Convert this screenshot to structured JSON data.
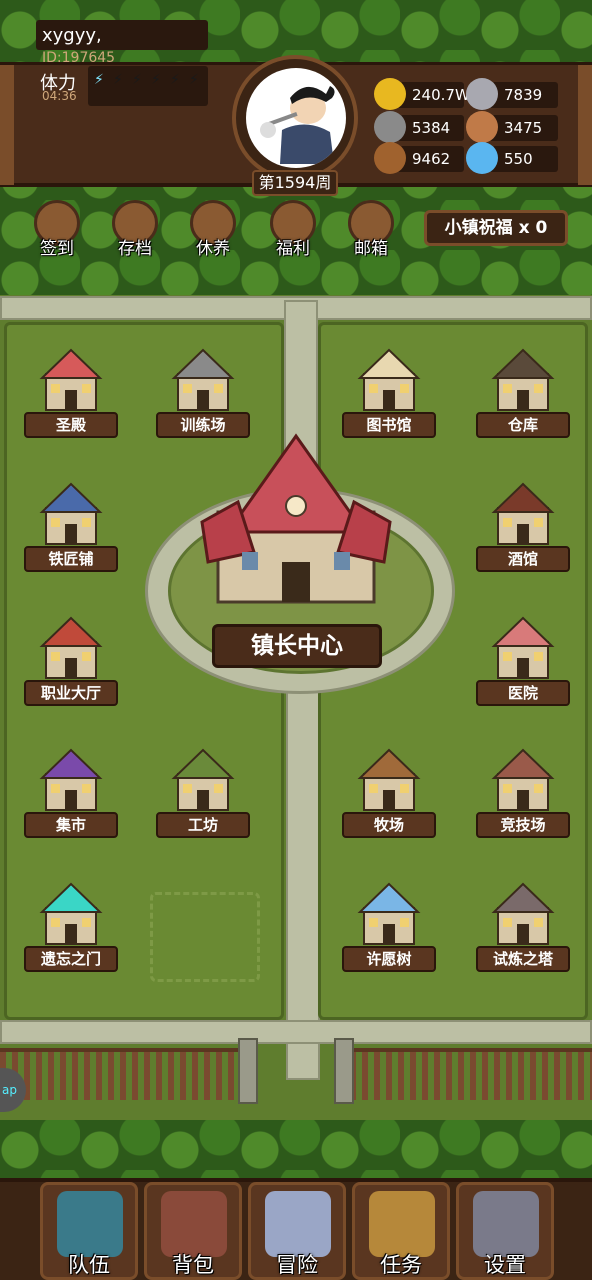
{
  "player": {
    "name": "xygyy,",
    "id": "ID:197645",
    "stamina_label": "体力",
    "stamina_timer": "04:36",
    "stamina_filled": 1,
    "stamina_max": 6
  },
  "week": "第1594周",
  "resources": [
    {
      "icon": "gold-coin-icon",
      "value": "240.7W",
      "color": "#e8b820"
    },
    {
      "icon": "iron-ingot-icon",
      "value": "7839",
      "color": "#a8a8b0"
    },
    {
      "icon": "stone-icon",
      "value": "5384",
      "color": "#8a8a8a"
    },
    {
      "icon": "leather-icon",
      "value": "3475",
      "color": "#c07a48"
    },
    {
      "icon": "wood-log-icon",
      "value": "9462",
      "color": "#a0622e"
    },
    {
      "icon": "crystal-icon",
      "value": "550",
      "color": "#5ab6f0"
    }
  ],
  "quick_actions": [
    {
      "label": "签到",
      "icon": "quill-scroll-icon"
    },
    {
      "label": "存档",
      "icon": "save-scroll-icon"
    },
    {
      "label": "休养",
      "icon": "rest-scroll-icon"
    },
    {
      "label": "福利",
      "icon": "shield-reward-icon"
    },
    {
      "label": "邮箱",
      "icon": "mail-icon"
    }
  ],
  "blessing": "小镇祝福 x 0",
  "buildings": [
    {
      "label": "圣殿",
      "icon": "temple-icon",
      "color": "#d65a5a"
    },
    {
      "label": "训练场",
      "icon": "training-ground-icon",
      "color": "#8a8a8a"
    },
    {
      "label": "图书馆",
      "icon": "library-icon",
      "color": "#e8d8b0"
    },
    {
      "label": "仓库",
      "icon": "warehouse-icon",
      "color": "#5a4a3a"
    },
    {
      "label": "铁匠铺",
      "icon": "blacksmith-icon",
      "color": "#4a6aaa"
    },
    {
      "label": "酒馆",
      "icon": "tavern-icon",
      "color": "#7a3a2a"
    },
    {
      "label": "职业大厅",
      "icon": "job-hall-icon",
      "color": "#c04a3a"
    },
    {
      "label": "医院",
      "icon": "hospital-icon",
      "color": "#d87a7a"
    },
    {
      "label": "集市",
      "icon": "market-icon",
      "color": "#7a4aaa"
    },
    {
      "label": "工坊",
      "icon": "workshop-icon",
      "color": "#6a8a3a"
    },
    {
      "label": "牧场",
      "icon": "ranch-icon",
      "color": "#a06a3a"
    },
    {
      "label": "竞技场",
      "icon": "arena-icon",
      "color": "#9a5a4a"
    },
    {
      "label": "遗忘之门",
      "icon": "forgotten-gate-icon",
      "color": "#3ad6c6"
    },
    {
      "label": "许愿树",
      "icon": "wishing-tree-icon",
      "color": "#7ab6e6"
    },
    {
      "label": "试炼之塔",
      "icon": "trial-tower-icon",
      "color": "#7a6a6a"
    }
  ],
  "town_hall": "镇长中心",
  "side_tab": "ap",
  "nav": [
    {
      "label": "队伍",
      "icon": "helmet-icon",
      "color": "#3a7a8a"
    },
    {
      "label": "背包",
      "icon": "backpack-icon",
      "color": "#8a4a3a"
    },
    {
      "label": "冒险",
      "icon": "crossed-swords-icon",
      "color": "#9aa6c6"
    },
    {
      "label": "任务",
      "icon": "quest-scroll-icon",
      "color": "#b6883a"
    },
    {
      "label": "设置",
      "icon": "gear-icon",
      "color": "#7a7a8a"
    }
  ]
}
